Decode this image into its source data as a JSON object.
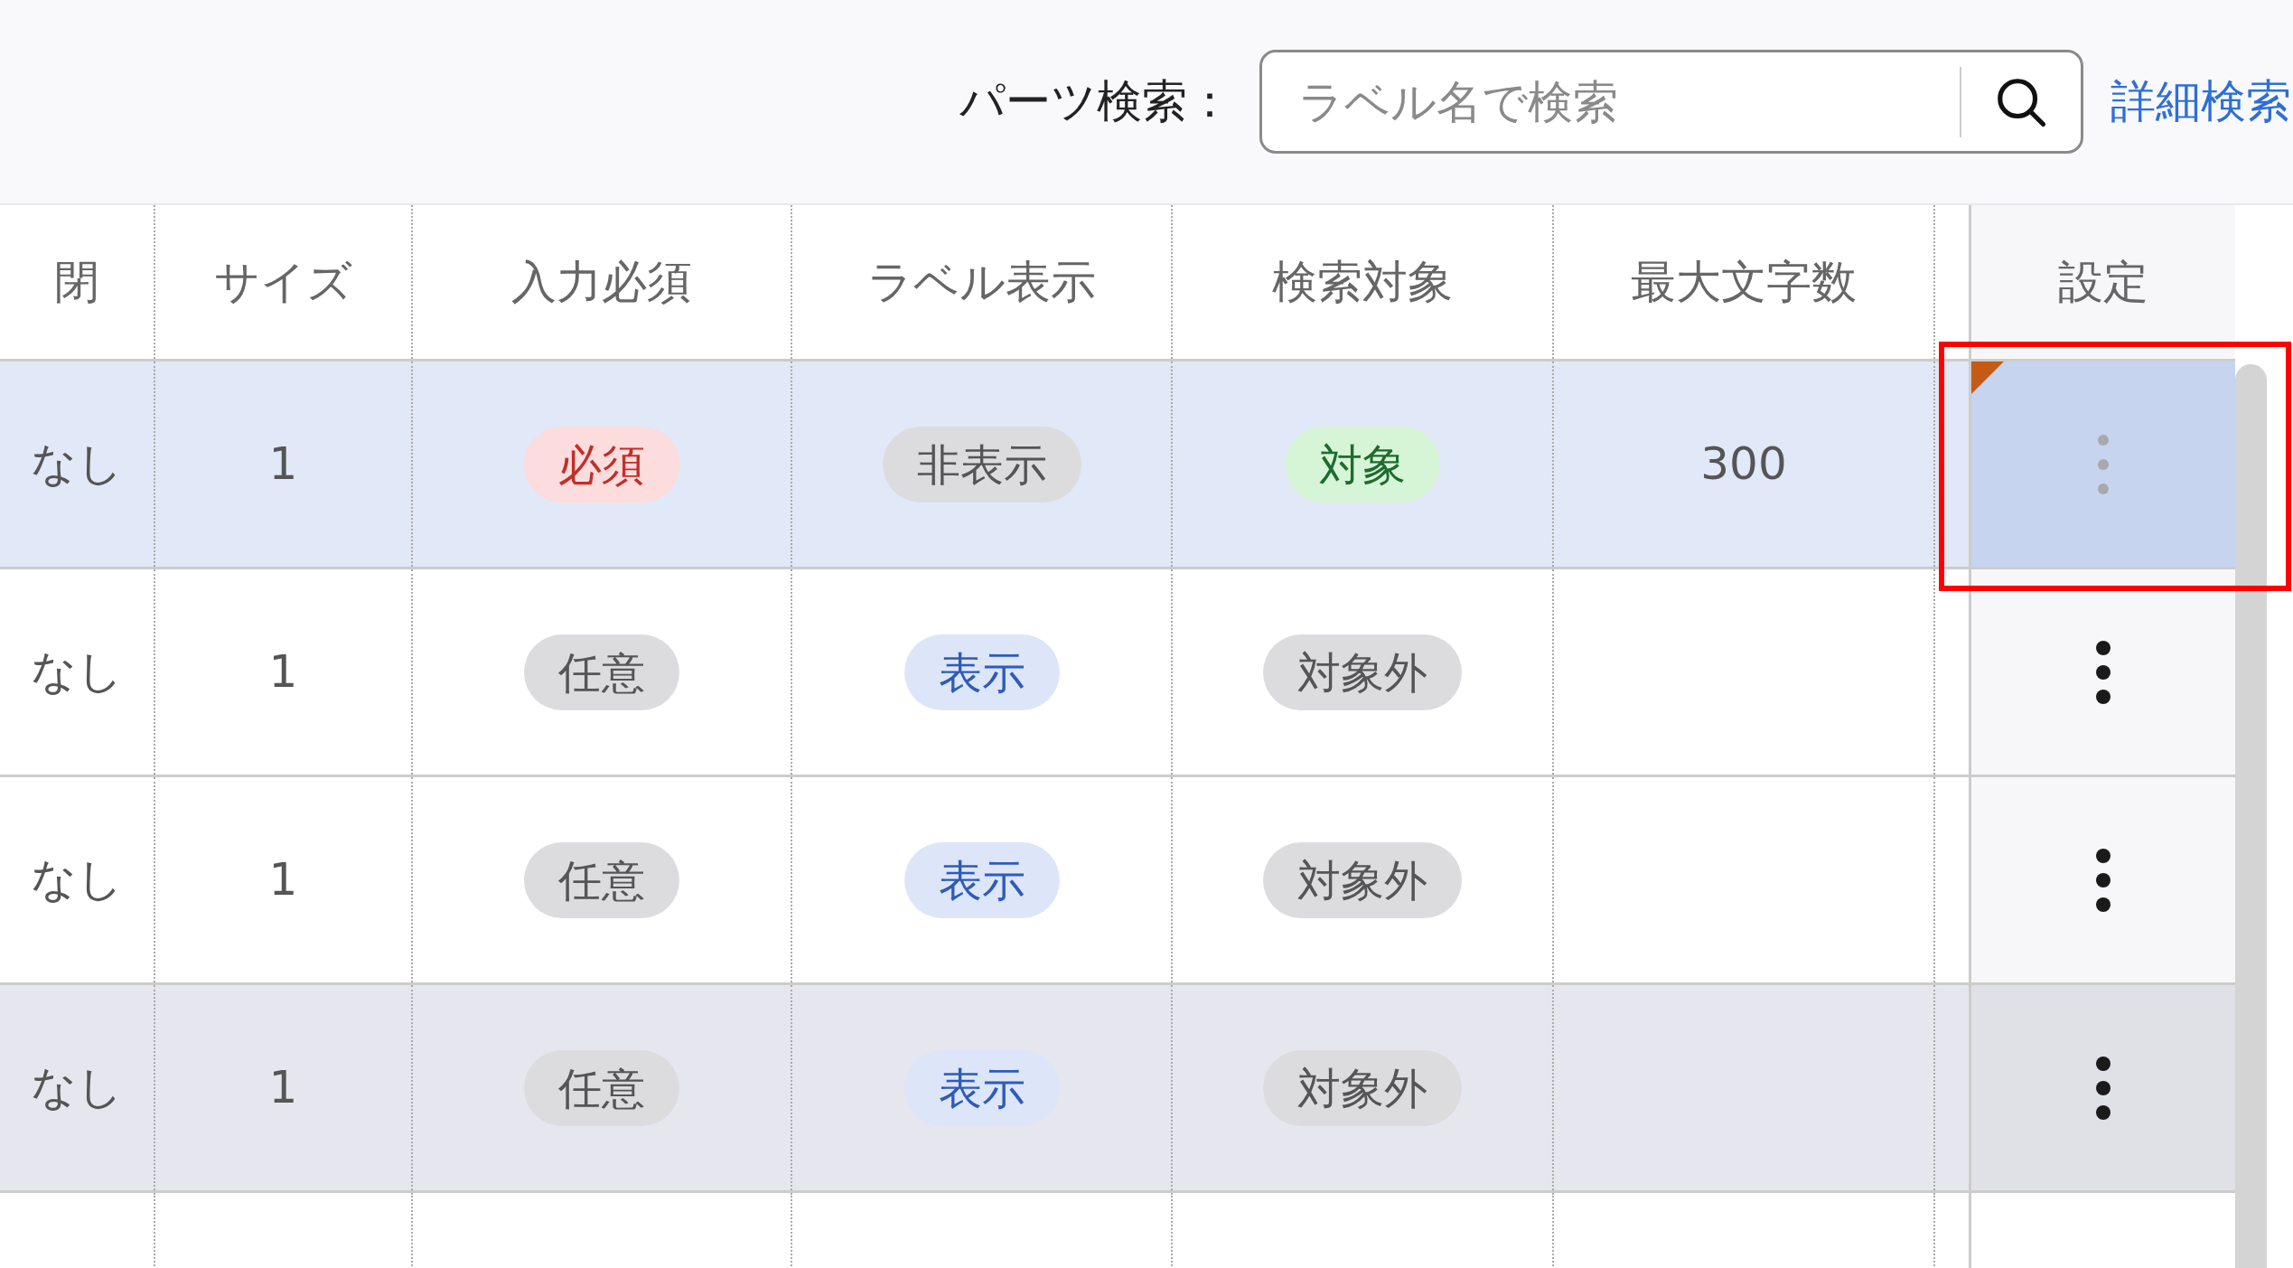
{
  "search": {
    "label": "パーツ検索：",
    "placeholder": "ラベル名で検索",
    "link": "詳細検索"
  },
  "columns": [
    "閉",
    "サイズ",
    "入力必須",
    "ラベル表示",
    "検索対象",
    "最大文字数",
    "設定"
  ],
  "rows": [
    {
      "selected": true,
      "highlighted": false,
      "flagged": true,
      "annotated": true,
      "menu_disabled": true,
      "cells": [
        {
          "kind": "text",
          "text": "なし"
        },
        {
          "kind": "text",
          "text": "1"
        },
        {
          "kind": "badge",
          "text": "必須",
          "color": "#fcdcdc"
        },
        {
          "kind": "badge",
          "text": "非表示",
          "color": "#dcdcdf"
        },
        {
          "kind": "badge",
          "text": "対象",
          "color": "#d6f5d6"
        },
        {
          "kind": "text",
          "text": "300"
        }
      ]
    },
    {
      "selected": false,
      "highlighted": false,
      "flagged": false,
      "annotated": false,
      "menu_disabled": false,
      "cells": [
        {
          "kind": "text",
          "text": "なし"
        },
        {
          "kind": "text",
          "text": "1"
        },
        {
          "kind": "badge",
          "text": "任意",
          "color": "#dcdcdf"
        },
        {
          "kind": "badge",
          "text": "表示",
          "color": "#dce6f8"
        },
        {
          "kind": "badge",
          "text": "対象外",
          "color": "#dcdcdf"
        },
        {
          "kind": "blank"
        }
      ]
    },
    {
      "selected": false,
      "highlighted": false,
      "flagged": false,
      "annotated": false,
      "menu_disabled": false,
      "cells": [
        {
          "kind": "text",
          "text": "なし"
        },
        {
          "kind": "text",
          "text": "1"
        },
        {
          "kind": "badge",
          "text": "任意",
          "color": "#dcdcdf"
        },
        {
          "kind": "badge",
          "text": "表示",
          "color": "#dce6f8"
        },
        {
          "kind": "badge",
          "text": "対象外",
          "color": "#dcdcdf"
        },
        {
          "kind": "blank"
        }
      ]
    },
    {
      "selected": false,
      "highlighted": true,
      "flagged": false,
      "annotated": false,
      "menu_disabled": false,
      "cells": [
        {
          "kind": "text",
          "text": "なし"
        },
        {
          "kind": "text",
          "text": "1"
        },
        {
          "kind": "badge",
          "text": "任意",
          "color": "#dcdcdf"
        },
        {
          "kind": "badge",
          "text": "表示",
          "color": "#dce6f8"
        },
        {
          "kind": "badge",
          "text": "対象外",
          "color": "#dcdcdf"
        },
        {
          "kind": "blank"
        }
      ]
    }
  ]
}
